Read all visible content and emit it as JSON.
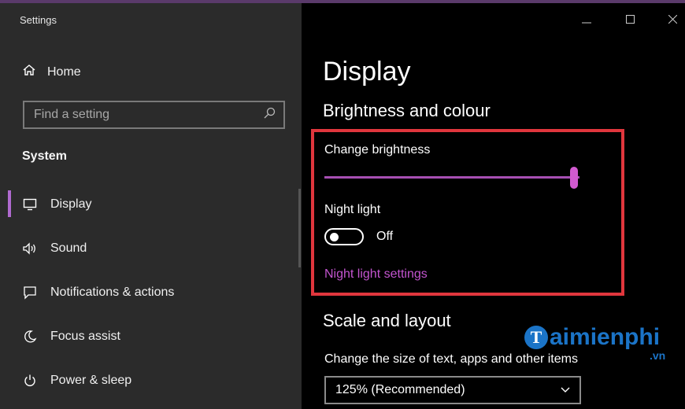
{
  "window": {
    "title": "Settings"
  },
  "sidebar": {
    "home_label": "Home",
    "search": {
      "placeholder": "Find a setting"
    },
    "section_title": "System",
    "items": [
      {
        "label": "Display",
        "icon": "monitor-icon",
        "active": true
      },
      {
        "label": "Sound",
        "icon": "speaker-icon",
        "active": false
      },
      {
        "label": "Notifications & actions",
        "icon": "notification-icon",
        "active": false
      },
      {
        "label": "Focus assist",
        "icon": "moon-icon",
        "active": false
      },
      {
        "label": "Power & sleep",
        "icon": "power-icon",
        "active": false
      }
    ]
  },
  "main": {
    "title": "Display",
    "brightness": {
      "heading": "Brightness and colour",
      "slider_label": "Change brightness",
      "slider_value_fraction": 1.0,
      "night_light_label": "Night light",
      "night_light_state": "Off",
      "night_light_link": "Night light settings"
    },
    "scale": {
      "heading": "Scale and layout",
      "text_size_label": "Change the size of text, apps and other items",
      "text_size_value": "125% (Recommended)"
    }
  },
  "watermark": {
    "brand": "aimienphi",
    "letter": "T",
    "suffix": ".vn"
  },
  "colors": {
    "accent": "#c354cf",
    "highlight_border": "#e0363d",
    "sidebar_bg": "#2b2b2b",
    "content_bg": "#000000"
  }
}
